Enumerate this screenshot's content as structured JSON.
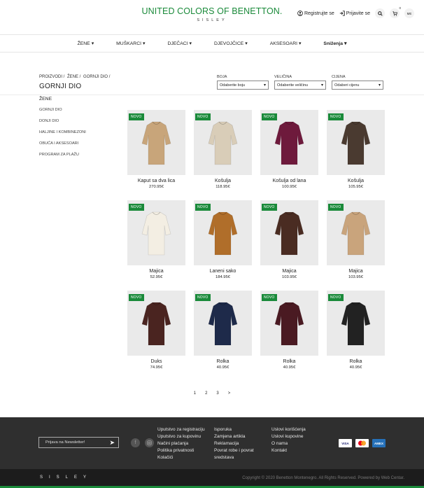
{
  "header": {
    "brand": "UNITED COLORS OF BENETTON.",
    "sub_brand": "SISLEY",
    "register": "Registrujte se",
    "login": "Prijavite se",
    "cart_count": "0",
    "language": "ME"
  },
  "nav": {
    "items": [
      {
        "label": "ŽENE"
      },
      {
        "label": "MUŠKARCI"
      },
      {
        "label": "DJEČACI"
      },
      {
        "label": "DJEVOJČICE"
      },
      {
        "label": "AKSESOARI"
      },
      {
        "label": "Sniženja"
      }
    ]
  },
  "breadcrumb": {
    "items": [
      "PROIZVODI /",
      "ŽENE /",
      "GORNJI DIO /"
    ],
    "title": "GORNJI DIO"
  },
  "filters": {
    "color_label": "BOJA",
    "color_value": "Odaberite boju",
    "size_label": "VELIČINA",
    "size_value": "Odaberite veličinu",
    "price_label": "CIJENA",
    "price_value": "Odaberi cijenu"
  },
  "sidebar": {
    "heading": "ŽENE",
    "items": [
      "GORNJI DIO",
      "DONJI DIO",
      "HALJINE I KOMBINEZONI",
      "OBUĆA I AKSESOARI",
      "PROGRAM ZA PLAŽU"
    ]
  },
  "products": [
    {
      "name": "Kaput sa dva lica",
      "price": "270.95€",
      "badge": "NOVO",
      "color": "#c8a57a"
    },
    {
      "name": "Košulja",
      "price": "118.95€",
      "badge": "NOVO",
      "color": "#d9cdb8"
    },
    {
      "name": "Košulja od lana",
      "price": "100.95€",
      "badge": "NOVO",
      "color": "#6e1a3c"
    },
    {
      "name": "Košulja",
      "price": "105.95€",
      "badge": "NOVO",
      "color": "#4a3a30"
    },
    {
      "name": "Majica",
      "price": "52.95€",
      "badge": "NOVO",
      "color": "#f3eee3"
    },
    {
      "name": "Laneni sako",
      "price": "184.95€",
      "badge": "NOVO",
      "color": "#b06e2a"
    },
    {
      "name": "Majica",
      "price": "103.95€",
      "badge": "NOVO",
      "color": "#4a2c22"
    },
    {
      "name": "Majica",
      "price": "103.95€",
      "badge": "NOVO",
      "color": "#c9a47c"
    },
    {
      "name": "Duks",
      "price": "74.95€",
      "badge": "NOVO",
      "color": "#4a2420"
    },
    {
      "name": "Rolka",
      "price": "40.95€",
      "badge": "NOVO",
      "color": "#1e2a4a"
    },
    {
      "name": "Rolka",
      "price": "40.95€",
      "badge": "NOVO",
      "color": "#4a1a22"
    },
    {
      "name": "Rolka",
      "price": "40.95€",
      "badge": "NOVO",
      "color": "#222222"
    }
  ],
  "pagination": {
    "pages": [
      "1",
      "2",
      "3",
      ">"
    ]
  },
  "footer": {
    "newsletter_placeholder": "Prijava na Newsletter!",
    "col1": [
      "Uputstvo za registraciju",
      "Uputstvo za kupovinu",
      "Načini plaćanja",
      "Politika privatnosti",
      "Kolačići"
    ],
    "col2": [
      "Isporuka",
      "Zamjena artikla",
      "Reklamacija",
      "Povrat robe i povrat sredstava"
    ],
    "col3": [
      "Uslovi korišćenja",
      "Uslovi kupovine",
      "O nama",
      "Kontakt"
    ],
    "payment": [
      "VISA",
      "MC",
      "AMEX"
    ],
    "bottom_brand": "SISLEY",
    "copyright": "Copyright © 2020 Benetton Montenegro. All Rights Reserved. Powered by Web Centar."
  }
}
